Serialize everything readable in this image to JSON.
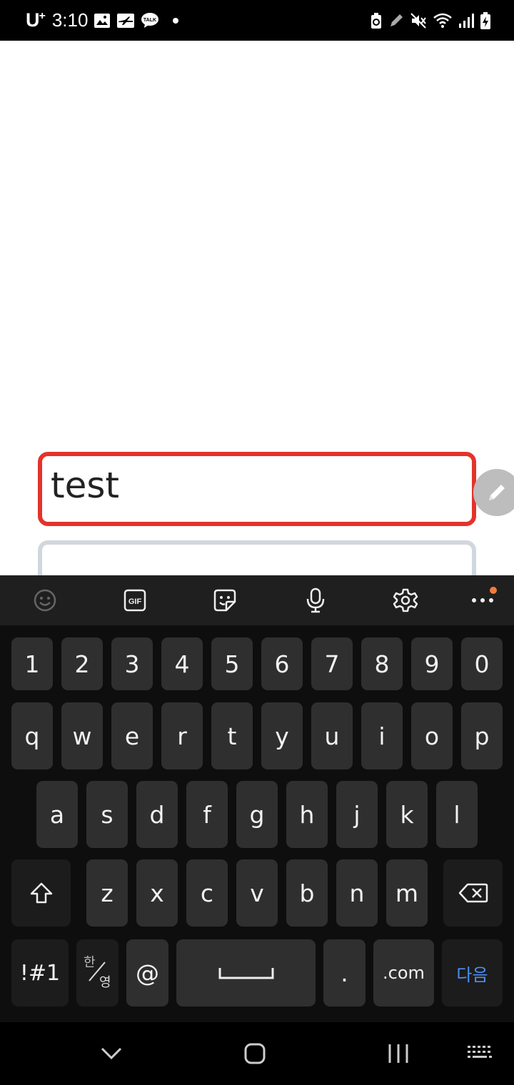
{
  "status_bar": {
    "carrier": "U",
    "carrier_sup": "+",
    "time": "3:10",
    "left_icons": [
      "gallery-icon",
      "airplane-app-icon",
      "talk-icon",
      "dot-icon"
    ],
    "right_icons": [
      "battery-saver-icon",
      "pen-icon",
      "mute-icon",
      "wifi-icon",
      "signal-icon",
      "battery-charging-icon"
    ],
    "talk_label": "TALK"
  },
  "form": {
    "field1_value": "test",
    "field2_value": ""
  },
  "colors": {
    "active_border": "#e4332b",
    "inactive_border": "#d1d7de",
    "keyboard_bg": "#0e0e0e",
    "key_bg": "#2f2f2f",
    "next_key": "#4d8ef5"
  },
  "keyboard": {
    "toolbar": [
      "emoji-icon",
      "gif-icon",
      "sticker-icon",
      "microphone-icon",
      "settings-icon",
      "more-icon"
    ],
    "gif_label": "GIF",
    "row_numbers": [
      "1",
      "2",
      "3",
      "4",
      "5",
      "6",
      "7",
      "8",
      "9",
      "0"
    ],
    "row_top": [
      "q",
      "w",
      "e",
      "r",
      "t",
      "y",
      "u",
      "i",
      "o",
      "p"
    ],
    "row_mid": [
      "a",
      "s",
      "d",
      "f",
      "g",
      "h",
      "j",
      "k",
      "l"
    ],
    "row_low": [
      "z",
      "x",
      "c",
      "v",
      "b",
      "n",
      "m"
    ],
    "symbols_label": "!#1",
    "lang_top": "한",
    "lang_bottom": "영",
    "at_label": "@",
    "period_label": ".",
    "com_label": ".com",
    "next_label": "다음"
  },
  "nav_bar": [
    "back-icon",
    "home-icon",
    "recents-icon",
    "keyboard-icon"
  ]
}
